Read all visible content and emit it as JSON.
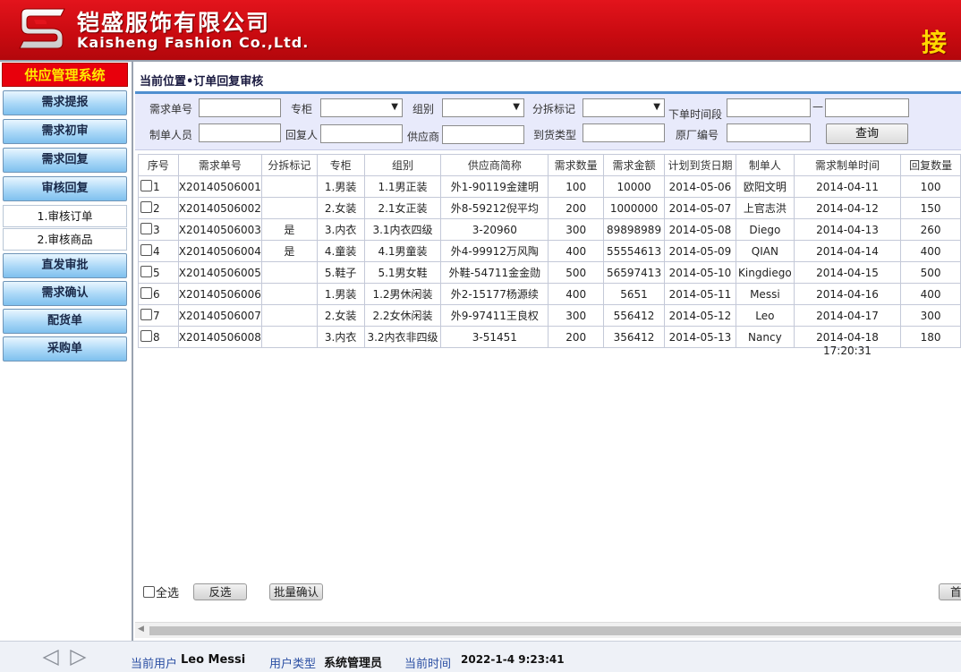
{
  "header": {
    "brand_cn": "铠盛服饰有限公司",
    "brand_en": "Kaisheng Fashion Co.,Ltd.",
    "welcome": "接",
    "bg_color": "#d10c12",
    "accent_color": "#ffd800"
  },
  "sidebar": {
    "title": "供应管理系统",
    "items": [
      {
        "label": "需求提报"
      },
      {
        "label": "需求初审"
      },
      {
        "label": "需求回复"
      },
      {
        "label": "审核回复"
      },
      {
        "label": "1.审核订单"
      },
      {
        "label": "2.审核商品"
      },
      {
        "label": "直发审批"
      },
      {
        "label": "需求确认"
      },
      {
        "label": "配货单"
      },
      {
        "label": "采购单"
      }
    ]
  },
  "main": {
    "breadcrumb": "当前位置•订单回复审核",
    "filters": {
      "order_no": "需求单号",
      "counter": "专柜",
      "group": "组别",
      "split": "分拆标记",
      "period": "下单时间段",
      "period_sep": "—",
      "creator": "制单人员",
      "replier": "回复人",
      "supplier": "供应商",
      "arrival_type": "到货类型",
      "factory_no": "原厂编号",
      "query_button": "查询"
    },
    "table": {
      "headers": [
        "序号",
        "需求单号",
        "分拆标记",
        "专柜",
        "组别",
        "供应商简称",
        "需求数量",
        "需求金额",
        "计划到货日期",
        "制单人",
        "需求制单时间",
        "回复数量"
      ],
      "rows": [
        {
          "no": "1",
          "order": "X20140506001",
          "split": "",
          "counter": "1.男装",
          "group": "1.1男正装",
          "supplier": "外1-90119金建明",
          "qty": "100",
          "amount": "10000",
          "plan_date": "2014-05-06",
          "creator": "欧阳文明",
          "created": "2014-04-11",
          "reply_qty": "100"
        },
        {
          "no": "2",
          "order": "X20140506002",
          "split": "",
          "counter": "2.女装",
          "group": "2.1女正装",
          "supplier": "外8-59212倪平均",
          "qty": "200",
          "amount": "1000000",
          "plan_date": "2014-05-07",
          "creator": "上官志洪",
          "created": "2014-04-12",
          "reply_qty": "150"
        },
        {
          "no": "3",
          "order": "X20140506003",
          "split": "是",
          "counter": "3.内衣",
          "group": "3.1内衣四级",
          "supplier": "3-20960",
          "qty": "300",
          "amount": "89898989",
          "plan_date": "2014-05-08",
          "creator": "Diego",
          "created": "2014-04-13",
          "reply_qty": "260"
        },
        {
          "no": "4",
          "order": "X20140506004",
          "split": "是",
          "counter": "4.童装",
          "group": "4.1男童装",
          "supplier": "外4-99912万风陶",
          "qty": "400",
          "amount": "55554613",
          "plan_date": "2014-05-09",
          "creator": "QIAN",
          "created": "2014-04-14",
          "reply_qty": "400"
        },
        {
          "no": "5",
          "order": "X20140506005",
          "split": "",
          "counter": "5.鞋子",
          "group": "5.1男女鞋",
          "supplier": "外鞋-54711金金勋",
          "qty": "500",
          "amount": "56597413",
          "plan_date": "2014-05-10",
          "creator": "Kingdiego",
          "created": "2014-04-15",
          "reply_qty": "500"
        },
        {
          "no": "6",
          "order": "X20140506006",
          "split": "",
          "counter": "1.男装",
          "group": "1.2男休闲装",
          "supplier": "外2-15177杨源续",
          "qty": "400",
          "amount": "5651",
          "plan_date": "2014-05-11",
          "creator": "Messi",
          "created": "2014-04-16",
          "reply_qty": "400"
        },
        {
          "no": "7",
          "order": "X20140506007",
          "split": "",
          "counter": "2.女装",
          "group": "2.2女休闲装",
          "supplier": "外9-97411王良权",
          "qty": "300",
          "amount": "556412",
          "plan_date": "2014-05-12",
          "creator": "Leo",
          "created": "2014-04-17",
          "reply_qty": "300"
        },
        {
          "no": "8",
          "order": "X20140506008",
          "split": "",
          "counter": "3.内衣",
          "group": "3.2内衣非四级",
          "supplier": "3-51451",
          "qty": "200",
          "amount": "356412",
          "plan_date": "2014-05-13",
          "creator": "Nancy",
          "created": "2014-04-18",
          "reply_qty": "180"
        }
      ],
      "extra_time": "17:20:31"
    },
    "actions": {
      "select_all": "全选",
      "invert": "反选",
      "batch_confirm": "批量确认",
      "first_page": "首"
    }
  },
  "footer": {
    "current_user_label": "当前用户",
    "current_user": "Leo Messi",
    "user_type_label": "用户类型",
    "user_type": "系统管理员",
    "current_time_label": "当前时间",
    "current_time": "2022-1-4 9:23:41"
  }
}
